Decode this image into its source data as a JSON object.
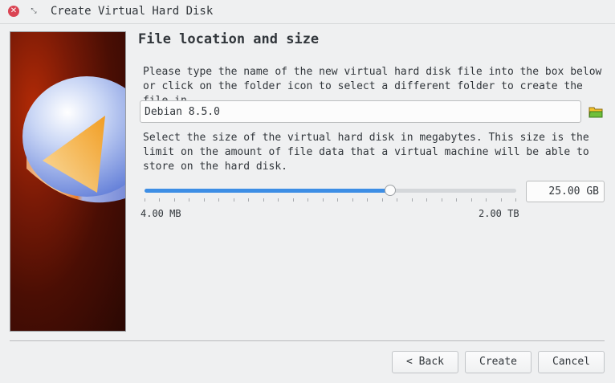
{
  "window": {
    "title": "Create Virtual Hard Disk",
    "close_icon": "close-icon",
    "restore_icon": "restore-icon"
  },
  "heading": "File location and size",
  "location": {
    "instructions": "Please type the name of the new virtual hard disk file into the box below or click on the folder icon to select a different folder to create the file in.",
    "filename": "Debian 8.5.0",
    "folder_icon": "folder-icon"
  },
  "size": {
    "instructions": "Select the size of the virtual hard disk in megabytes. This size is the limit on the amount of file data that a virtual machine will be able to store on the hard disk.",
    "slider_fraction": 0.66,
    "min_label": "4.00 MB",
    "max_label": "2.00 TB",
    "value": "25.00 GB"
  },
  "buttons": {
    "back": "< Back",
    "create": "Create",
    "cancel": "Cancel"
  },
  "colors": {
    "accent": "#3d8ee5",
    "close": "#da4453"
  }
}
